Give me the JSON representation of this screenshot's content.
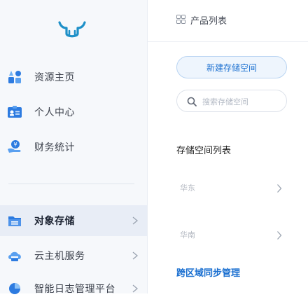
{
  "sidebar": {
    "items": [
      {
        "label": "资源主页",
        "icon": "resource-home-icon"
      },
      {
        "label": "个人中心",
        "icon": "id-card-icon"
      },
      {
        "label": "财务统计",
        "icon": "finance-hand-icon"
      },
      {
        "label": "对象存储",
        "icon": "folder-icon",
        "active": true
      },
      {
        "label": "云主机服务",
        "icon": "cloud-server-icon"
      },
      {
        "label": "智能日志管理平台",
        "icon": "log-chart-icon"
      }
    ]
  },
  "header": {
    "title": "产品列表",
    "icon": "grid-icon"
  },
  "main": {
    "new_button": "新建存储空间",
    "search_placeholder": "搜索存储空间",
    "section_title": "存储空间列表",
    "regions": [
      "华东",
      "华南"
    ],
    "sync_link": "跨区域同步管理"
  },
  "colors": {
    "accent": "#1a6fd0",
    "active_bg": "#e8edf6",
    "logo": "#1e90c8"
  }
}
